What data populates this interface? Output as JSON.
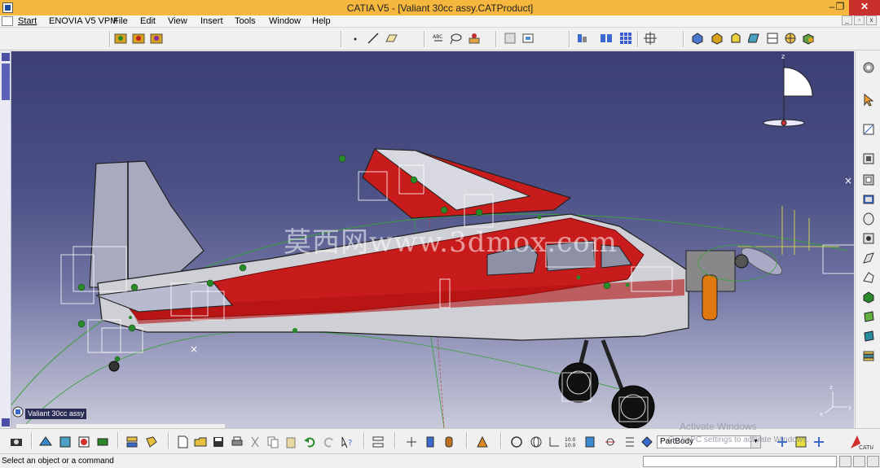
{
  "window": {
    "title": "CATIA V5 - [Valiant 30cc assy.CATProduct]",
    "minimize_label": "–",
    "restore_label": "❐",
    "close_label": "✕"
  },
  "menu": {
    "items": [
      {
        "label": "Start"
      },
      {
        "label": "ENOVIA V5 VPM"
      },
      {
        "label": "File"
      },
      {
        "label": "Edit"
      },
      {
        "label": "View"
      },
      {
        "label": "Insert"
      },
      {
        "label": "Tools"
      },
      {
        "label": "Window"
      },
      {
        "label": "Help"
      }
    ],
    "mdi": {
      "minimize": "_",
      "restore": "▫",
      "close": "x"
    }
  },
  "viewport": {
    "watermark": "莫西网www.3dmox.com",
    "tree_root_label": "Valiant 30cc assy",
    "compass_axis_label": "z",
    "axis_x_label": "x",
    "axis_y_label": "y",
    "axis_z_label": "z"
  },
  "bottom": {
    "part_combo_value": "PartBody",
    "activate_title": "Activate Windows",
    "activate_sub": "Go to PC settings to activate Windows."
  },
  "status": {
    "message": "Select an object or a command"
  },
  "colors": {
    "titlebar": "#f5b73d",
    "fuselage_red": "#c81c1c",
    "viewport_top": "#3b3f74",
    "viewport_bottom": "#c9cada"
  }
}
